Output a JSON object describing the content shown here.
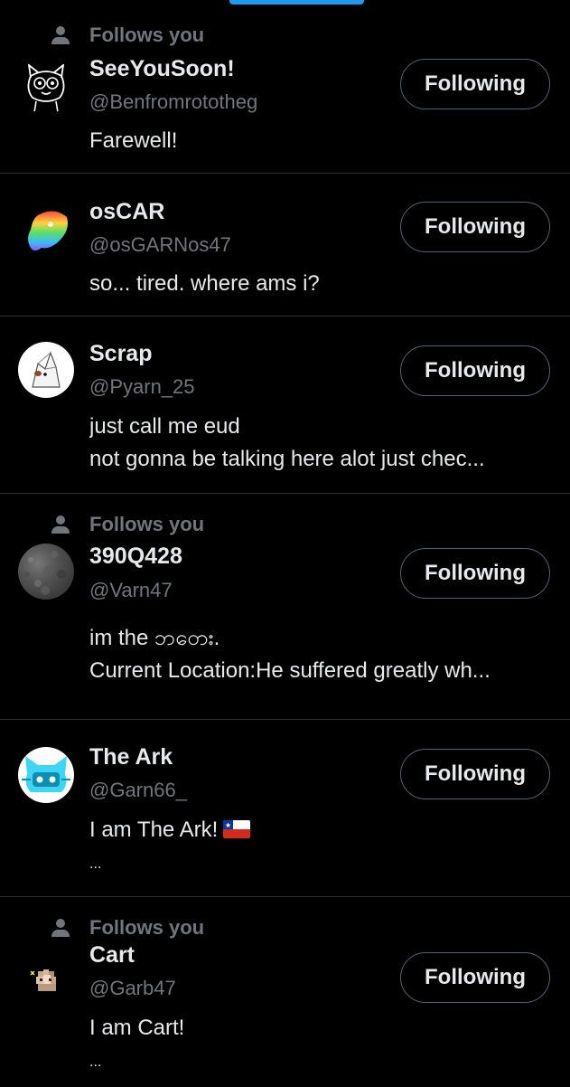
{
  "colors": {
    "background": "#000000",
    "primary_text": "#e7e9ea",
    "secondary_text": "#71767b",
    "divider": "#2f3336",
    "accent": "#1d9bf0"
  },
  "follows_you_label": "Follows you",
  "users": [
    {
      "follows_you": true,
      "name": "SeeYouSoon!",
      "handle": "@Benfromrototheg",
      "bio": [
        "Farewell!"
      ],
      "button": "Following",
      "avatar_icon": "cat-doodle-avatar"
    },
    {
      "follows_you": false,
      "name": "osCAR",
      "handle": "@osGARNos47",
      "bio": [
        "so... tired. where ams i?"
      ],
      "button": "Following",
      "avatar_icon": "rainbow-avatar"
    },
    {
      "follows_you": false,
      "name": "Scrap",
      "handle": "@Pyarn_25",
      "bio": [
        "just call me eud",
        "not gonna be talking here alot just chec..."
      ],
      "button": "Following",
      "avatar_icon": "paper-fox-avatar"
    },
    {
      "follows_you": true,
      "name": "390Q428",
      "handle": "@Varn47",
      "bio": [
        "im the ဘဝေား.",
        "Current Location:He suffered greatly wh..."
      ],
      "button": "Following",
      "avatar_icon": "grey-noise-avatar"
    },
    {
      "follows_you": false,
      "name": "The Ark",
      "handle": "@Garn66_",
      "bio": [
        "I am The Ark!",
        "..."
      ],
      "bio_flag_icon": "chile-flag-icon",
      "button": "Following",
      "avatar_icon": "cyan-robot-cat-avatar"
    },
    {
      "follows_you": true,
      "name": "Cart",
      "handle": "@Garb47",
      "bio": [
        "I am Cart!",
        "..."
      ],
      "button": "Following",
      "avatar_icon": "pixel-cat-avatar"
    }
  ]
}
